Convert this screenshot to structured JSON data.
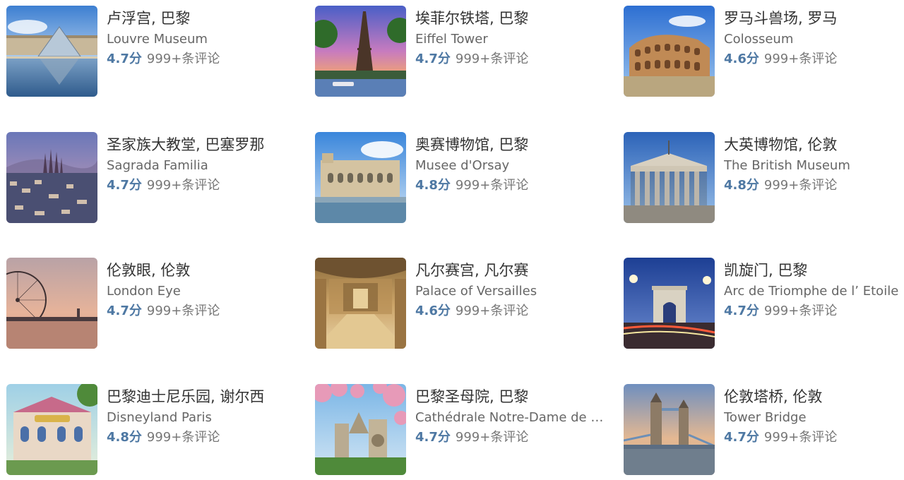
{
  "cards": [
    {
      "title": "卢浮宫, 巴黎",
      "subtitle": "Louvre Museum",
      "score": "4.7分",
      "reviews": "999+条评论",
      "thumb": "louvre"
    },
    {
      "title": "埃菲尔铁塔, 巴黎",
      "subtitle": "Eiffel Tower",
      "score": "4.7分",
      "reviews": "999+条评论",
      "thumb": "eiffel"
    },
    {
      "title": "罗马斗兽场, 罗马",
      "subtitle": "Colosseum",
      "score": "4.6分",
      "reviews": "999+条评论",
      "thumb": "colosseum"
    },
    {
      "title": "圣家族大教堂, 巴塞罗那",
      "subtitle": "Sagrada Familia",
      "score": "4.7分",
      "reviews": "999+条评论",
      "thumb": "sagrada"
    },
    {
      "title": "奥赛博物馆, 巴黎",
      "subtitle": "Musee d'Orsay",
      "score": "4.8分",
      "reviews": "999+条评论",
      "thumb": "orsay"
    },
    {
      "title": "大英博物馆, 伦敦",
      "subtitle": "The British Museum",
      "score": "4.8分",
      "reviews": "999+条评论",
      "thumb": "british"
    },
    {
      "title": "伦敦眼, 伦敦",
      "subtitle": "London Eye",
      "score": "4.7分",
      "reviews": "999+条评论",
      "thumb": "londoneye"
    },
    {
      "title": "凡尔赛宫, 凡尔赛",
      "subtitle": "Palace of Versailles",
      "score": "4.6分",
      "reviews": "999+条评论",
      "thumb": "versailles"
    },
    {
      "title": "凯旋门, 巴黎",
      "subtitle": "Arc de Triomphe de l’ Etoile",
      "score": "4.7分",
      "reviews": "999+条评论",
      "thumb": "arc"
    },
    {
      "title": "巴黎迪士尼乐园, 谢尔西",
      "subtitle": "Disneyland Paris",
      "score": "4.8分",
      "reviews": "999+条评论",
      "thumb": "disney"
    },
    {
      "title": "巴黎圣母院, 巴黎",
      "subtitle": "Cathédrale Notre-Dame de …",
      "score": "4.7分",
      "reviews": "999+条评论",
      "thumb": "notredame"
    },
    {
      "title": "伦敦塔桥, 伦敦",
      "subtitle": "Tower Bridge",
      "score": "4.7分",
      "reviews": "999+条评论",
      "thumb": "towerbridge"
    }
  ]
}
